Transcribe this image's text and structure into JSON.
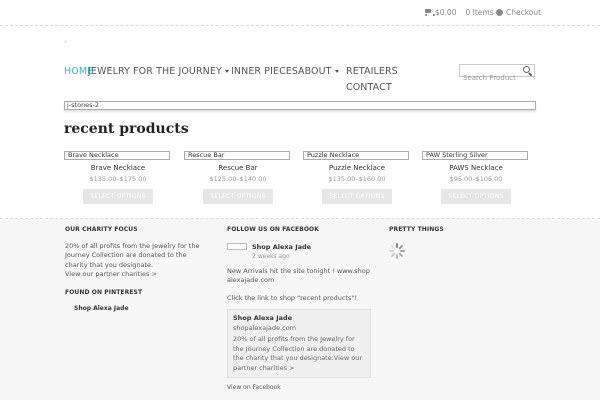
{
  "header": {
    "cart_total": "$0.00",
    "cart_items": "0 Items",
    "checkout_label": "Checkout",
    "logo_text": "°"
  },
  "nav": {
    "home": "HOME",
    "jewelry": "JEWELRY FOR THE JOURNEY",
    "inner": "INNER PIECES",
    "about": "ABOUT",
    "retailers": "RETAILERS",
    "contact": "CONTACT"
  },
  "search": {
    "placeholder": "Search Product"
  },
  "breadcrumb": "j-stones-2",
  "section_title": "recent products",
  "products": [
    {
      "image_alt": "Brave Necklace",
      "name": "Brave Necklace",
      "price": "$135.00–$175.00",
      "button": "SELECT OPTIONS"
    },
    {
      "image_alt": "Rescue Bar",
      "name": "Rescue Bar",
      "price": "$125.00–$140.00",
      "button": "SELECT OPTIONS"
    },
    {
      "image_alt": "Puzzle Necklace",
      "name": "Puzzle Necklace",
      "price": "$135.00–$160.00",
      "button": "SELECT OPTIONS"
    },
    {
      "image_alt": "PAW Sterling Silver",
      "name": "PAWS Necklace",
      "price": "$95.00–$105.00",
      "button": "SELECT OPTIONS"
    }
  ],
  "footer": {
    "charity_heading": "OUR CHARITY FOCUS",
    "charity_text": "20% of all profits from the Jewelry for the Journey Collection are donated to the charity that you designate.",
    "charity_link": "View our partner charities >",
    "pinterest_heading": "FOUND ON PINTEREST",
    "pinterest_name": "Shop Alexa Jade",
    "facebook_heading": "FOLLOW US ON FACEBOOK",
    "fb_page_name": "Shop Alexa Jade",
    "fb_time": "2 weeks ago",
    "fb_post_1": "New Arrivals hit the site tonight ! www.shopalexajade.com",
    "fb_post_2": "Click the link to shop \"recent products\"!",
    "fb_card_title": "Shop Alexa Jade",
    "fb_card_url": "shopalexajade.com",
    "fb_card_text": "20% of all profits from the Jewelry for the Journey Collection are donated to the charity that you designate.View our partner charities >",
    "fb_view_link": "View on Facebook",
    "pretty_heading": "PRETTY THINGS"
  },
  "colors": {
    "accent": "#3fb5c2",
    "button": "#e6e6e6",
    "footer_bg": "#f7f7f7"
  },
  "icons": {
    "cart": "cart-icon",
    "checkout": "checkout-icon",
    "search": "search-icon",
    "loading": "spinner-icon"
  }
}
